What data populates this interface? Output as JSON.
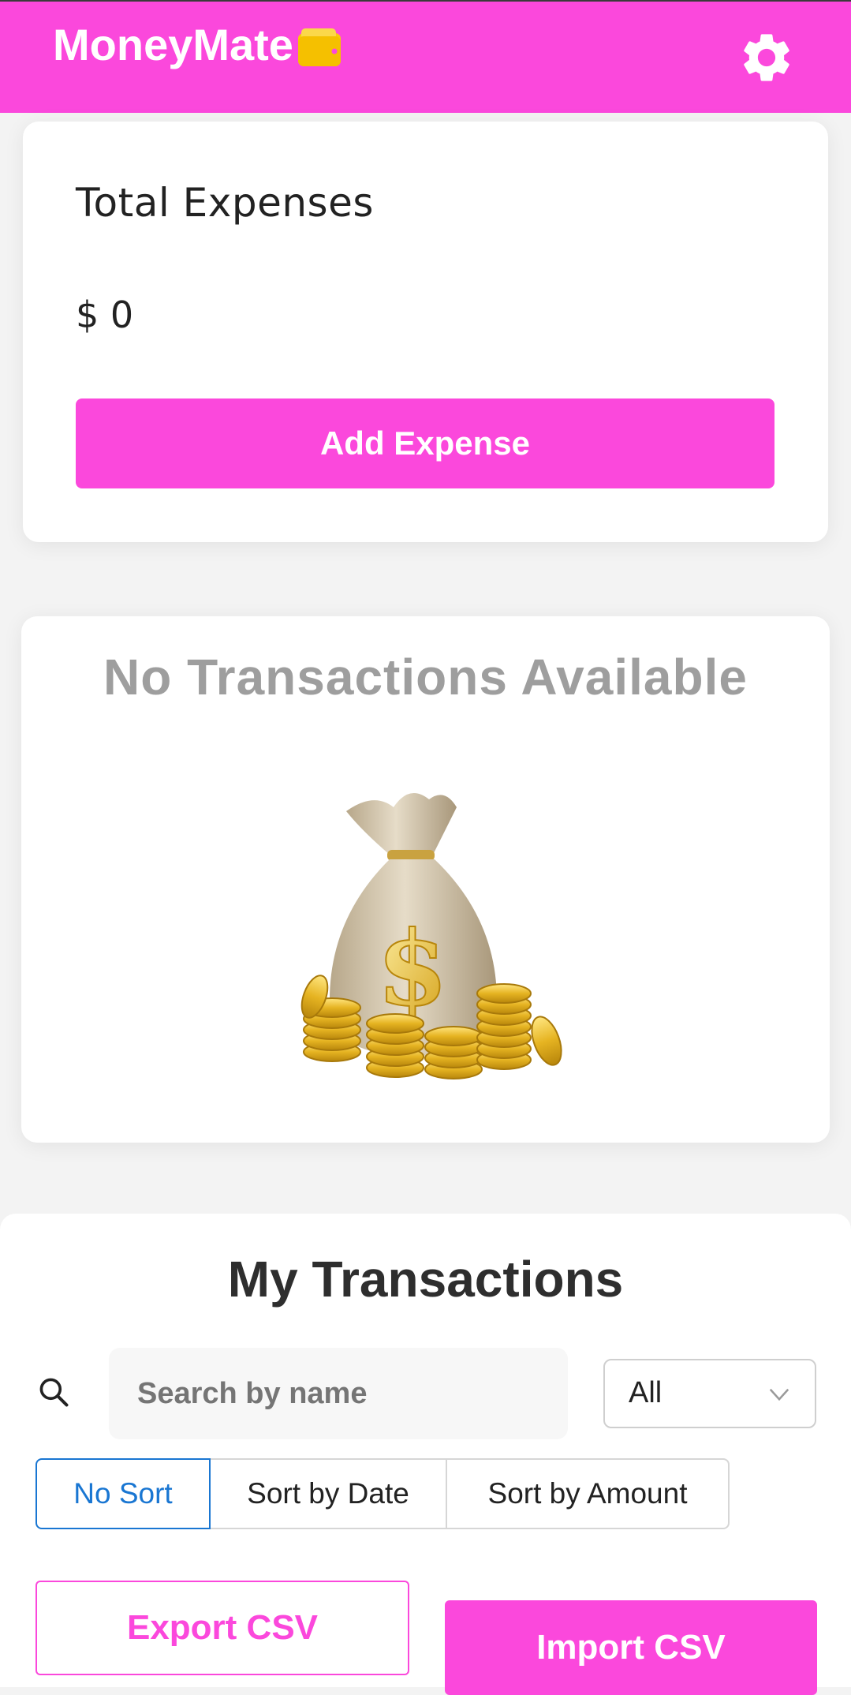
{
  "header": {
    "title": "MoneyMate",
    "brand_color": "#fb48dc",
    "wallet_icon": "wallet-icon",
    "settings_icon": "gear-icon"
  },
  "summary": {
    "label": "Total Expenses",
    "value": "$ 0",
    "add_button": "Add Expense"
  },
  "empty_state": {
    "message": "No Transactions Available",
    "illustration": "money-bag-icon"
  },
  "transactions": {
    "title": "My Transactions",
    "search": {
      "placeholder": "Search by name",
      "value": ""
    },
    "filter": {
      "selected": "All"
    },
    "sort_options": [
      {
        "label": "No Sort",
        "active": true
      },
      {
        "label": "Sort by Date",
        "active": false
      },
      {
        "label": "Sort by Amount",
        "active": false
      }
    ],
    "export_button": "Export CSV",
    "import_button": "Import CSV"
  }
}
